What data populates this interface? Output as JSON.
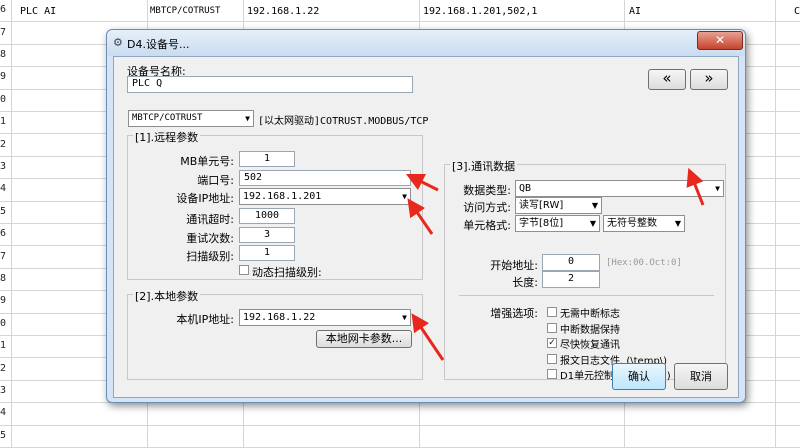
{
  "spreadsheet": {
    "row_numbers": [
      "6",
      "7",
      "8",
      "9",
      "0",
      "1",
      "2",
      "3",
      "4",
      "5",
      "6",
      "7",
      "8",
      "9",
      "0",
      "1",
      "2",
      "3",
      "4",
      "5"
    ],
    "first_row": {
      "name": "PLC AI",
      "driver": "MBTCP/COTRUST",
      "local_ip": "192.168.1.22",
      "remote": "192.168.1.201,502,1",
      "type": "AI",
      "extra": "C"
    }
  },
  "dialog": {
    "title": "D4.设备号...",
    "close_symbol": "✕",
    "name_label": "设备号名称:",
    "name_value": "PLC Q",
    "prev_button": "«",
    "next_button": "»",
    "driver_value": "MBTCP/COTRUST",
    "driver_desc": "[以太网驱动]COTRUST.MODBUS/TCP",
    "remote": {
      "title": "[1].远程参数",
      "mb_unit_label": "MB单元号:",
      "mb_unit_value": "1",
      "port_label": "端口号:",
      "port_value": "502",
      "ip_label": "设备IP地址:",
      "ip_value": "192.168.1.201",
      "timeout_label": "通讯超时:",
      "timeout_value": "1000",
      "retry_label": "重试次数:",
      "retry_value": "3",
      "scan_label": "扫描级别:",
      "scan_value": "1",
      "dynamic_scan_label": "动态扫描级别:"
    },
    "local": {
      "title": "[2].本地参数",
      "ip_label": "本机IP地址:",
      "ip_value": "192.168.1.22",
      "nic_button": "本地网卡参数..."
    },
    "comm": {
      "title": "[3].通讯数据",
      "data_type_label": "数据类型:",
      "data_type_value": "QB",
      "access_label": "访问方式:",
      "access_value": "读写[RW]",
      "unit_format_label": "单元格式:",
      "unit_format_value": "字节[8位]",
      "unit_sign_value": "无符号整数",
      "start_label": "开始地址:",
      "start_value": "0",
      "start_hint": "[Hex:00.Oct:0]",
      "length_label": "长度:",
      "length_value": "2",
      "enhance_label": "增强选项:",
      "options": [
        {
          "label": "无需中断标志",
          "checked": false
        },
        {
          "label": "中断数据保持",
          "checked": false
        },
        {
          "label": "尽快恢复通讯",
          "checked": true
        },
        {
          "label": "报文日志文件. (\\temp\\)",
          "checked": false
        },
        {
          "label": "D1单元控制读. (0/1-15)",
          "checked": false
        }
      ]
    },
    "ok_button": "确认",
    "cancel_button": "取消"
  },
  "colors": {
    "annotation_arrow": "#e8281c",
    "title_bar": "#c9dcf0",
    "dialog_body": "#f0f0f0"
  }
}
